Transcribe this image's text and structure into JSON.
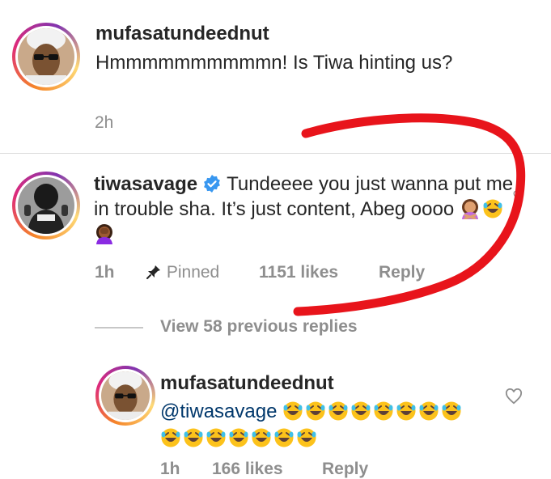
{
  "comments": [
    {
      "username": "mufasatundeednut",
      "text": "Hmmmmmmmmmmn! Is Tiwa hinting us?",
      "time": "2h"
    },
    {
      "username": "tiwasavage",
      "text": "Tundeeee you just wanna put me in trouble sha. It’s just content, Abeg oooo",
      "emojis": [
        "woman-gesturing-no",
        "rolling-on-floor-laughing",
        "woman-facepalming"
      ],
      "time": "1h",
      "pinned_label": "Pinned",
      "likes": "1151 likes",
      "reply_label": "Reply"
    }
  ],
  "view_replies_label": "View 58 previous replies",
  "reply": {
    "username": "mufasatundeednut",
    "mention": "@tiwasavage",
    "emoji_count": 15,
    "time": "1h",
    "likes": "166 likes",
    "reply_label": "Reply"
  },
  "annotation_color": "#e8141b"
}
